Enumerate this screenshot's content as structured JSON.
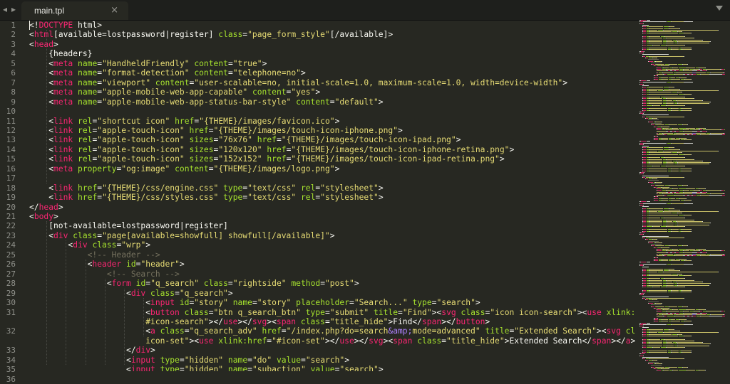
{
  "tab": {
    "title": "main.tpl"
  },
  "nav": {
    "back": "◂",
    "forward": "▸",
    "close": "×"
  },
  "line_numbers": [
    "1",
    "2",
    "3",
    "4",
    "5",
    "6",
    "7",
    "8",
    "9",
    "10",
    "11",
    "12",
    "13",
    "14",
    "15",
    "16",
    "17",
    "18",
    "19",
    "20",
    "21",
    "22",
    "23",
    "24",
    "25",
    "26",
    "27",
    "28",
    "29",
    "30",
    "31",
    "32",
    "33",
    "34",
    "35",
    "36"
  ],
  "lines": [
    [
      [
        "t",
        "<!"
      ],
      [
        "tag",
        "DOCTYPE"
      ],
      [
        "t",
        " html>"
      ]
    ],
    [
      [
        "t",
        "<"
      ],
      [
        "tag",
        "html"
      ],
      [
        "t",
        "[available=lostpassword|register] "
      ],
      [
        "attr",
        "class"
      ],
      [
        "t",
        "="
      ],
      [
        "str",
        "\"page_form_style\""
      ],
      [
        "t",
        "[/available]>"
      ]
    ],
    [
      [
        "t",
        "<"
      ],
      [
        "tag",
        "head"
      ],
      [
        "t",
        ">"
      ]
    ],
    [
      [
        "t",
        "    {headers}"
      ]
    ],
    [
      [
        "t",
        "    <"
      ],
      [
        "tag",
        "meta"
      ],
      [
        "t",
        " "
      ],
      [
        "attr",
        "name"
      ],
      [
        "t",
        "="
      ],
      [
        "str",
        "\"HandheldFriendly\""
      ],
      [
        "t",
        " "
      ],
      [
        "attr",
        "content"
      ],
      [
        "t",
        "="
      ],
      [
        "str",
        "\"true\""
      ],
      [
        "t",
        ">"
      ]
    ],
    [
      [
        "t",
        "    <"
      ],
      [
        "tag",
        "meta"
      ],
      [
        "t",
        " "
      ],
      [
        "attr",
        "name"
      ],
      [
        "t",
        "="
      ],
      [
        "str",
        "\"format-detection\""
      ],
      [
        "t",
        " "
      ],
      [
        "attr",
        "content"
      ],
      [
        "t",
        "="
      ],
      [
        "str",
        "\"telephone=no\""
      ],
      [
        "t",
        ">"
      ]
    ],
    [
      [
        "t",
        "    <"
      ],
      [
        "tag",
        "meta"
      ],
      [
        "t",
        " "
      ],
      [
        "attr",
        "name"
      ],
      [
        "t",
        "="
      ],
      [
        "str",
        "\"viewport\""
      ],
      [
        "t",
        " "
      ],
      [
        "attr",
        "content"
      ],
      [
        "t",
        "="
      ],
      [
        "str",
        "\"user-scalable=no, initial-scale=1.0, maximum-scale=1.0, width=device-width\""
      ],
      [
        "t",
        ">"
      ]
    ],
    [
      [
        "t",
        "    <"
      ],
      [
        "tag",
        "meta"
      ],
      [
        "t",
        " "
      ],
      [
        "attr",
        "name"
      ],
      [
        "t",
        "="
      ],
      [
        "str",
        "\"apple-mobile-web-app-capable\""
      ],
      [
        "t",
        " "
      ],
      [
        "attr",
        "content"
      ],
      [
        "t",
        "="
      ],
      [
        "str",
        "\"yes\""
      ],
      [
        "t",
        ">"
      ]
    ],
    [
      [
        "t",
        "    <"
      ],
      [
        "tag",
        "meta"
      ],
      [
        "t",
        " "
      ],
      [
        "attr",
        "name"
      ],
      [
        "t",
        "="
      ],
      [
        "str",
        "\"apple-mobile-web-app-status-bar-style\""
      ],
      [
        "t",
        " "
      ],
      [
        "attr",
        "content"
      ],
      [
        "t",
        "="
      ],
      [
        "str",
        "\"default\""
      ],
      [
        "t",
        ">"
      ]
    ],
    [],
    [
      [
        "t",
        "    <"
      ],
      [
        "tag",
        "link"
      ],
      [
        "t",
        " "
      ],
      [
        "attr",
        "rel"
      ],
      [
        "t",
        "="
      ],
      [
        "str",
        "\"shortcut icon\""
      ],
      [
        "t",
        " "
      ],
      [
        "attr",
        "href"
      ],
      [
        "t",
        "="
      ],
      [
        "str",
        "\"{THEME}/images/favicon.ico\""
      ],
      [
        "t",
        ">"
      ]
    ],
    [
      [
        "t",
        "    <"
      ],
      [
        "tag",
        "link"
      ],
      [
        "t",
        " "
      ],
      [
        "attr",
        "rel"
      ],
      [
        "t",
        "="
      ],
      [
        "str",
        "\"apple-touch-icon\""
      ],
      [
        "t",
        " "
      ],
      [
        "attr",
        "href"
      ],
      [
        "t",
        "="
      ],
      [
        "str",
        "\"{THEME}/images/touch-icon-iphone.png\""
      ],
      [
        "t",
        ">"
      ]
    ],
    [
      [
        "t",
        "    <"
      ],
      [
        "tag",
        "link"
      ],
      [
        "t",
        " "
      ],
      [
        "attr",
        "rel"
      ],
      [
        "t",
        "="
      ],
      [
        "str",
        "\"apple-touch-icon\""
      ],
      [
        "t",
        " "
      ],
      [
        "attr",
        "sizes"
      ],
      [
        "t",
        "="
      ],
      [
        "str",
        "\"76x76\""
      ],
      [
        "t",
        " "
      ],
      [
        "attr",
        "href"
      ],
      [
        "t",
        "="
      ],
      [
        "str",
        "\"{THEME}/images/touch-icon-ipad.png\""
      ],
      [
        "t",
        ">"
      ]
    ],
    [
      [
        "t",
        "    <"
      ],
      [
        "tag",
        "link"
      ],
      [
        "t",
        " "
      ],
      [
        "attr",
        "rel"
      ],
      [
        "t",
        "="
      ],
      [
        "str",
        "\"apple-touch-icon\""
      ],
      [
        "t",
        " "
      ],
      [
        "attr",
        "sizes"
      ],
      [
        "t",
        "="
      ],
      [
        "str",
        "\"120x120\""
      ],
      [
        "t",
        " "
      ],
      [
        "attr",
        "href"
      ],
      [
        "t",
        "="
      ],
      [
        "str",
        "\"{THEME}/images/touch-icon-iphone-retina.png\""
      ],
      [
        "t",
        ">"
      ]
    ],
    [
      [
        "t",
        "    <"
      ],
      [
        "tag",
        "link"
      ],
      [
        "t",
        " "
      ],
      [
        "attr",
        "rel"
      ],
      [
        "t",
        "="
      ],
      [
        "str",
        "\"apple-touch-icon\""
      ],
      [
        "t",
        " "
      ],
      [
        "attr",
        "sizes"
      ],
      [
        "t",
        "="
      ],
      [
        "str",
        "\"152x152\""
      ],
      [
        "t",
        " "
      ],
      [
        "attr",
        "href"
      ],
      [
        "t",
        "="
      ],
      [
        "str",
        "\"{THEME}/images/touch-icon-ipad-retina.png\""
      ],
      [
        "t",
        ">"
      ]
    ],
    [
      [
        "t",
        "    <"
      ],
      [
        "tag",
        "meta"
      ],
      [
        "t",
        " "
      ],
      [
        "attr",
        "property"
      ],
      [
        "t",
        "="
      ],
      [
        "str",
        "\"og:image\""
      ],
      [
        "t",
        " "
      ],
      [
        "attr",
        "content"
      ],
      [
        "t",
        "="
      ],
      [
        "str",
        "\"{THEME}/images/logo.png\""
      ],
      [
        "t",
        ">"
      ]
    ],
    [],
    [
      [
        "t",
        "    <"
      ],
      [
        "tag",
        "link"
      ],
      [
        "t",
        " "
      ],
      [
        "attr",
        "href"
      ],
      [
        "t",
        "="
      ],
      [
        "str",
        "\"{THEME}/css/engine.css\""
      ],
      [
        "t",
        " "
      ],
      [
        "attr",
        "type"
      ],
      [
        "t",
        "="
      ],
      [
        "str",
        "\"text/css\""
      ],
      [
        "t",
        " "
      ],
      [
        "attr",
        "rel"
      ],
      [
        "t",
        "="
      ],
      [
        "str",
        "\"stylesheet\""
      ],
      [
        "t",
        ">"
      ]
    ],
    [
      [
        "t",
        "    <"
      ],
      [
        "tag",
        "link"
      ],
      [
        "t",
        " "
      ],
      [
        "attr",
        "href"
      ],
      [
        "t",
        "="
      ],
      [
        "str",
        "\"{THEME}/css/styles.css\""
      ],
      [
        "t",
        " "
      ],
      [
        "attr",
        "type"
      ],
      [
        "t",
        "="
      ],
      [
        "str",
        "\"text/css\""
      ],
      [
        "t",
        " "
      ],
      [
        "attr",
        "rel"
      ],
      [
        "t",
        "="
      ],
      [
        "str",
        "\"stylesheet\""
      ],
      [
        "t",
        ">"
      ]
    ],
    [
      [
        "t",
        "</"
      ],
      [
        "tag",
        "head"
      ],
      [
        "t",
        ">"
      ]
    ],
    [
      [
        "t",
        "<"
      ],
      [
        "tag",
        "body"
      ],
      [
        "t",
        ">"
      ]
    ],
    [
      [
        "t",
        "    [not-available=lostpassword|register]"
      ]
    ],
    [
      [
        "t",
        "    <"
      ],
      [
        "tag",
        "div"
      ],
      [
        "t",
        " "
      ],
      [
        "attr",
        "class"
      ],
      [
        "t",
        "="
      ],
      [
        "str",
        "\"page[available=showfull] showfull[/available]\""
      ],
      [
        "t",
        ">"
      ]
    ],
    [
      [
        "t",
        "        <"
      ],
      [
        "tag",
        "div"
      ],
      [
        "t",
        " "
      ],
      [
        "attr",
        "class"
      ],
      [
        "t",
        "="
      ],
      [
        "str",
        "\"wrp\""
      ],
      [
        "t",
        ">"
      ]
    ],
    [
      [
        "cmt",
        "            <!-- Header -->"
      ]
    ],
    [
      [
        "t",
        "            <"
      ],
      [
        "tag",
        "header"
      ],
      [
        "t",
        " "
      ],
      [
        "attr",
        "id"
      ],
      [
        "t",
        "="
      ],
      [
        "str",
        "\"header\""
      ],
      [
        "t",
        ">"
      ]
    ],
    [
      [
        "cmt",
        "                <!-- Search -->"
      ]
    ],
    [
      [
        "t",
        "                <"
      ],
      [
        "tag",
        "form"
      ],
      [
        "t",
        " "
      ],
      [
        "attr",
        "id"
      ],
      [
        "t",
        "="
      ],
      [
        "str",
        "\"q_search\""
      ],
      [
        "t",
        " "
      ],
      [
        "attr",
        "class"
      ],
      [
        "t",
        "="
      ],
      [
        "str",
        "\"rightside\""
      ],
      [
        "t",
        " "
      ],
      [
        "attr",
        "method"
      ],
      [
        "t",
        "="
      ],
      [
        "str",
        "\"post\""
      ],
      [
        "t",
        ">"
      ]
    ],
    [
      [
        "t",
        "                    <"
      ],
      [
        "tag",
        "div"
      ],
      [
        "t",
        " "
      ],
      [
        "attr",
        "class"
      ],
      [
        "t",
        "="
      ],
      [
        "str",
        "\"q_search\""
      ],
      [
        "t",
        ">"
      ]
    ],
    [
      [
        "t",
        "                        <"
      ],
      [
        "tag",
        "input"
      ],
      [
        "t",
        " "
      ],
      [
        "attr",
        "id"
      ],
      [
        "t",
        "="
      ],
      [
        "str",
        "\"story\""
      ],
      [
        "t",
        " "
      ],
      [
        "attr",
        "name"
      ],
      [
        "t",
        "="
      ],
      [
        "str",
        "\"story\""
      ],
      [
        "t",
        " "
      ],
      [
        "attr",
        "placeholder"
      ],
      [
        "t",
        "="
      ],
      [
        "str",
        "\"Search...\""
      ],
      [
        "t",
        " "
      ],
      [
        "attr",
        "type"
      ],
      [
        "t",
        "="
      ],
      [
        "str",
        "\"search\""
      ],
      [
        "t",
        ">"
      ]
    ],
    [
      [
        "t",
        "                        <"
      ],
      [
        "tag",
        "button"
      ],
      [
        "t",
        " "
      ],
      [
        "attr",
        "class"
      ],
      [
        "t",
        "="
      ],
      [
        "str",
        "\"btn q_search_btn\""
      ],
      [
        "t",
        " "
      ],
      [
        "attr",
        "type"
      ],
      [
        "t",
        "="
      ],
      [
        "str",
        "\"submit\""
      ],
      [
        "t",
        " "
      ],
      [
        "attr",
        "title"
      ],
      [
        "t",
        "="
      ],
      [
        "str",
        "\"Find\""
      ],
      [
        "t",
        "><"
      ],
      [
        "tag",
        "svg"
      ],
      [
        "t",
        " "
      ],
      [
        "attr",
        "class"
      ],
      [
        "t",
        "="
      ],
      [
        "str",
        "\"icon icon-search\""
      ],
      [
        "t",
        "><"
      ],
      [
        "tag",
        "use"
      ],
      [
        "t",
        " "
      ],
      [
        "attr",
        "xlink:href"
      ],
      [
        "t",
        "="
      ],
      [
        "str",
        "\""
      ]
    ],
    [
      [
        "str",
        "                        #icon-search\""
      ],
      [
        "t",
        "></"
      ],
      [
        "tag",
        "use"
      ],
      [
        "t",
        "></"
      ],
      [
        "tag",
        "svg"
      ],
      [
        "t",
        "><"
      ],
      [
        "tag",
        "span"
      ],
      [
        "t",
        " "
      ],
      [
        "attr",
        "class"
      ],
      [
        "t",
        "="
      ],
      [
        "str",
        "\"title_hide\""
      ],
      [
        "t",
        ">Find</"
      ],
      [
        "tag",
        "span"
      ],
      [
        "t",
        "></"
      ],
      [
        "tag",
        "button"
      ],
      [
        "t",
        ">"
      ]
    ],
    [
      [
        "t",
        "                        <"
      ],
      [
        "tag",
        "a"
      ],
      [
        "t",
        " "
      ],
      [
        "attr",
        "class"
      ],
      [
        "t",
        "="
      ],
      [
        "str",
        "\"q_search_adv\""
      ],
      [
        "t",
        " "
      ],
      [
        "attr",
        "href"
      ],
      [
        "t",
        "="
      ],
      [
        "str",
        "\"/index.php?do=search"
      ],
      [
        "ent",
        "&amp;"
      ],
      [
        "str",
        "mode=advanced\""
      ],
      [
        "t",
        " "
      ],
      [
        "attr",
        "title"
      ],
      [
        "t",
        "="
      ],
      [
        "str",
        "\"Extended Search\""
      ],
      [
        "t",
        "><"
      ],
      [
        "tag",
        "svg"
      ],
      [
        "t",
        " "
      ],
      [
        "attr",
        "class"
      ],
      [
        "t",
        "="
      ],
      [
        "str",
        "\"icon"
      ]
    ],
    [
      [
        "str",
        "                        icon-set\""
      ],
      [
        "t",
        "><"
      ],
      [
        "tag",
        "use"
      ],
      [
        "t",
        " "
      ],
      [
        "attr",
        "xlink:href"
      ],
      [
        "t",
        "="
      ],
      [
        "str",
        "\"#icon-set\""
      ],
      [
        "t",
        "></"
      ],
      [
        "tag",
        "use"
      ],
      [
        "t",
        "></"
      ],
      [
        "tag",
        "svg"
      ],
      [
        "t",
        "><"
      ],
      [
        "tag",
        "span"
      ],
      [
        "t",
        " "
      ],
      [
        "attr",
        "class"
      ],
      [
        "t",
        "="
      ],
      [
        "str",
        "\"title_hide\""
      ],
      [
        "t",
        ">Extended Search</"
      ],
      [
        "tag",
        "span"
      ],
      [
        "t",
        "></"
      ],
      [
        "tag",
        "a"
      ],
      [
        "t",
        ">"
      ]
    ],
    [
      [
        "t",
        "                    </"
      ],
      [
        "tag",
        "div"
      ],
      [
        "t",
        ">"
      ]
    ],
    [
      [
        "t",
        "                    <"
      ],
      [
        "tag",
        "input"
      ],
      [
        "t",
        " "
      ],
      [
        "attr",
        "type"
      ],
      [
        "t",
        "="
      ],
      [
        "str",
        "\"hidden\""
      ],
      [
        "t",
        " "
      ],
      [
        "attr",
        "name"
      ],
      [
        "t",
        "="
      ],
      [
        "str",
        "\"do\""
      ],
      [
        "t",
        " "
      ],
      [
        "attr",
        "value"
      ],
      [
        "t",
        "="
      ],
      [
        "str",
        "\"search\""
      ],
      [
        "t",
        ">"
      ]
    ],
    [
      [
        "t",
        "                    <"
      ],
      [
        "tag",
        "input"
      ],
      [
        "t",
        " "
      ],
      [
        "attr",
        "type"
      ],
      [
        "t",
        "="
      ],
      [
        "str",
        "\"hidden\""
      ],
      [
        "t",
        " "
      ],
      [
        "attr",
        "name"
      ],
      [
        "t",
        "="
      ],
      [
        "str",
        "\"subaction\""
      ],
      [
        "t",
        " "
      ],
      [
        "attr",
        "value"
      ],
      [
        "t",
        "="
      ],
      [
        "str",
        "\"search\""
      ],
      [
        "t",
        ">"
      ]
    ]
  ],
  "colors": {
    "background": "#272822",
    "tag": "#f92672",
    "attribute": "#a6e22e",
    "string": "#e6db74",
    "comment": "#75715e",
    "entity": "#ae81ff",
    "text": "#f8f8f2"
  }
}
